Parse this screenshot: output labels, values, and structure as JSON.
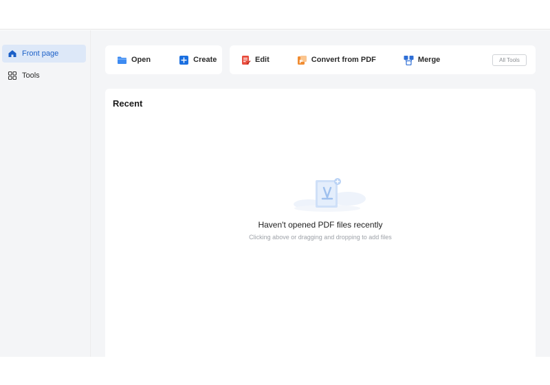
{
  "sidebar": {
    "items": [
      {
        "label": "Front page",
        "icon": "home-icon",
        "active": true
      },
      {
        "label": "Tools",
        "icon": "grid-icon",
        "active": false
      }
    ]
  },
  "toolbar": {
    "primary": [
      {
        "label": "Open",
        "icon": "folder-icon"
      },
      {
        "label": "Create",
        "icon": "plus-icon"
      }
    ],
    "secondary": [
      {
        "label": "Edit",
        "icon": "edit-icon"
      },
      {
        "label": "Convert from PDF",
        "icon": "convert-icon"
      },
      {
        "label": "Merge",
        "icon": "merge-icon"
      }
    ],
    "all_tools_label": "All Tools"
  },
  "recent": {
    "title": "Recent",
    "empty_title": "Haven't opened PDF files recently",
    "empty_subtitle": "Clicking above or dragging and dropping to add files",
    "empty_icon": "pdf-file-icon"
  },
  "colors": {
    "accent": "#1a73e8",
    "active_bg": "#dde8f8",
    "folder": "#3d8bf2",
    "create": "#1a6fe0",
    "edit": "#e84c3d",
    "convert": "#f08c32",
    "merge": "#2f6fd6"
  }
}
